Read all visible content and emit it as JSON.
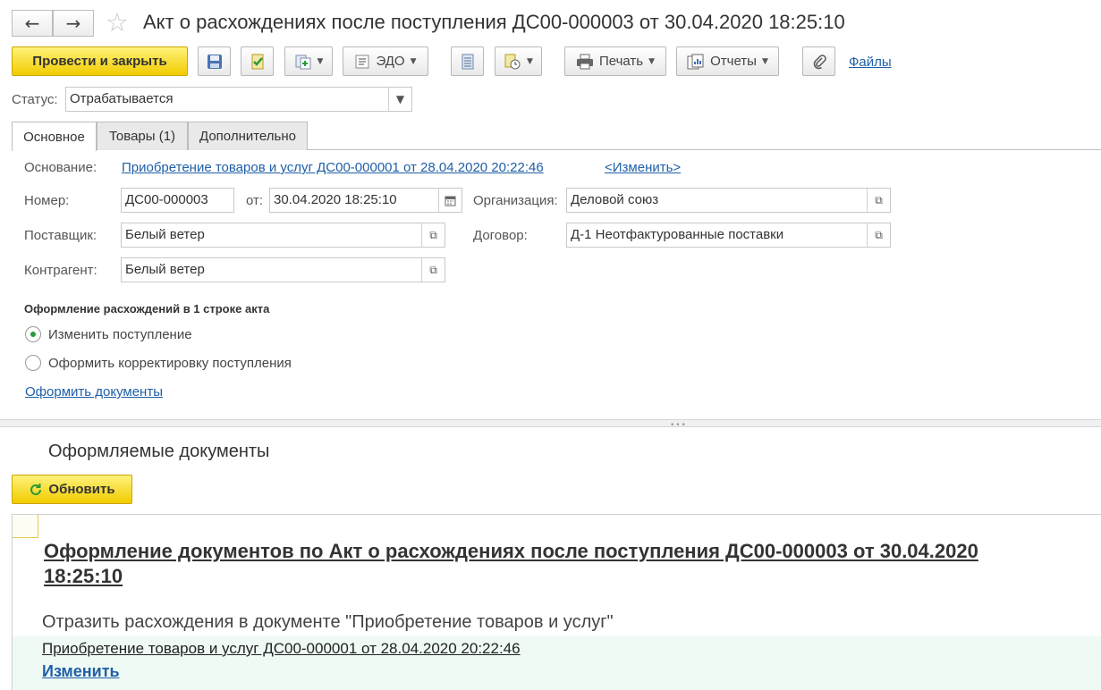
{
  "header": {
    "back_icon": "arrow-left-icon",
    "forward_icon": "arrow-right-icon",
    "favorite_icon": "star-icon",
    "title": "Акт о расхождениях после поступления ДС00-000003 от 30.04.2020 18:25:10"
  },
  "toolbar": {
    "post_close_label": "Провести и закрыть",
    "edo_label": "ЭДО",
    "print_label": "Печать",
    "reports_label": "Отчеты",
    "files_label": "Файлы"
  },
  "status": {
    "label": "Статус:",
    "value": "Отрабатывается"
  },
  "tabs": [
    {
      "label": "Основное",
      "active": true
    },
    {
      "label": "Товары (1)",
      "active": false
    },
    {
      "label": "Дополнительно",
      "active": false
    }
  ],
  "main": {
    "basis_label": "Основание:",
    "basis_link": "Приобретение товаров и услуг ДС00-000001 от 28.04.2020 20:22:46",
    "change_link": "<Изменить>",
    "number_label": "Номер:",
    "number_value": "ДС00-000003",
    "date_label": "от:",
    "date_value": "30.04.2020 18:25:10",
    "org_label": "Организация:",
    "org_value": "Деловой союз",
    "supplier_label": "Поставщик:",
    "supplier_value": "Белый ветер",
    "contract_label": "Договор:",
    "contract_value": "Д-1 Неотфактурованные поставки",
    "counterparty_label": "Контрагент:",
    "counterparty_value": "Белый ветер",
    "section_title": "Оформление расхождений в 1 строке акта",
    "radio_options": [
      "Изменить поступление",
      "Оформить корректировку поступления"
    ],
    "selected_option": "Изменить поступление",
    "make_docs_link": "Оформить документы"
  },
  "docs": {
    "title": "Оформляемые документы",
    "refresh_label": "Обновить",
    "heading_line1": "Оформление документов по Акт о расхождениях после поступления ДС00-000003 от 30.04.2020",
    "heading_line2": "18:25:10",
    "reflect_text": "Отразить расхождения в документе \"Приобретение товаров и услуг\"",
    "doc_link": "Приобретение товаров и услуг ДС00-000001 от 28.04.2020 20:22:46",
    "change_link": "Изменить"
  },
  "colors": {
    "accent_yellow": "#f5d20a",
    "link_blue": "#1f5fa8",
    "radio_green": "#2a9a3a"
  }
}
